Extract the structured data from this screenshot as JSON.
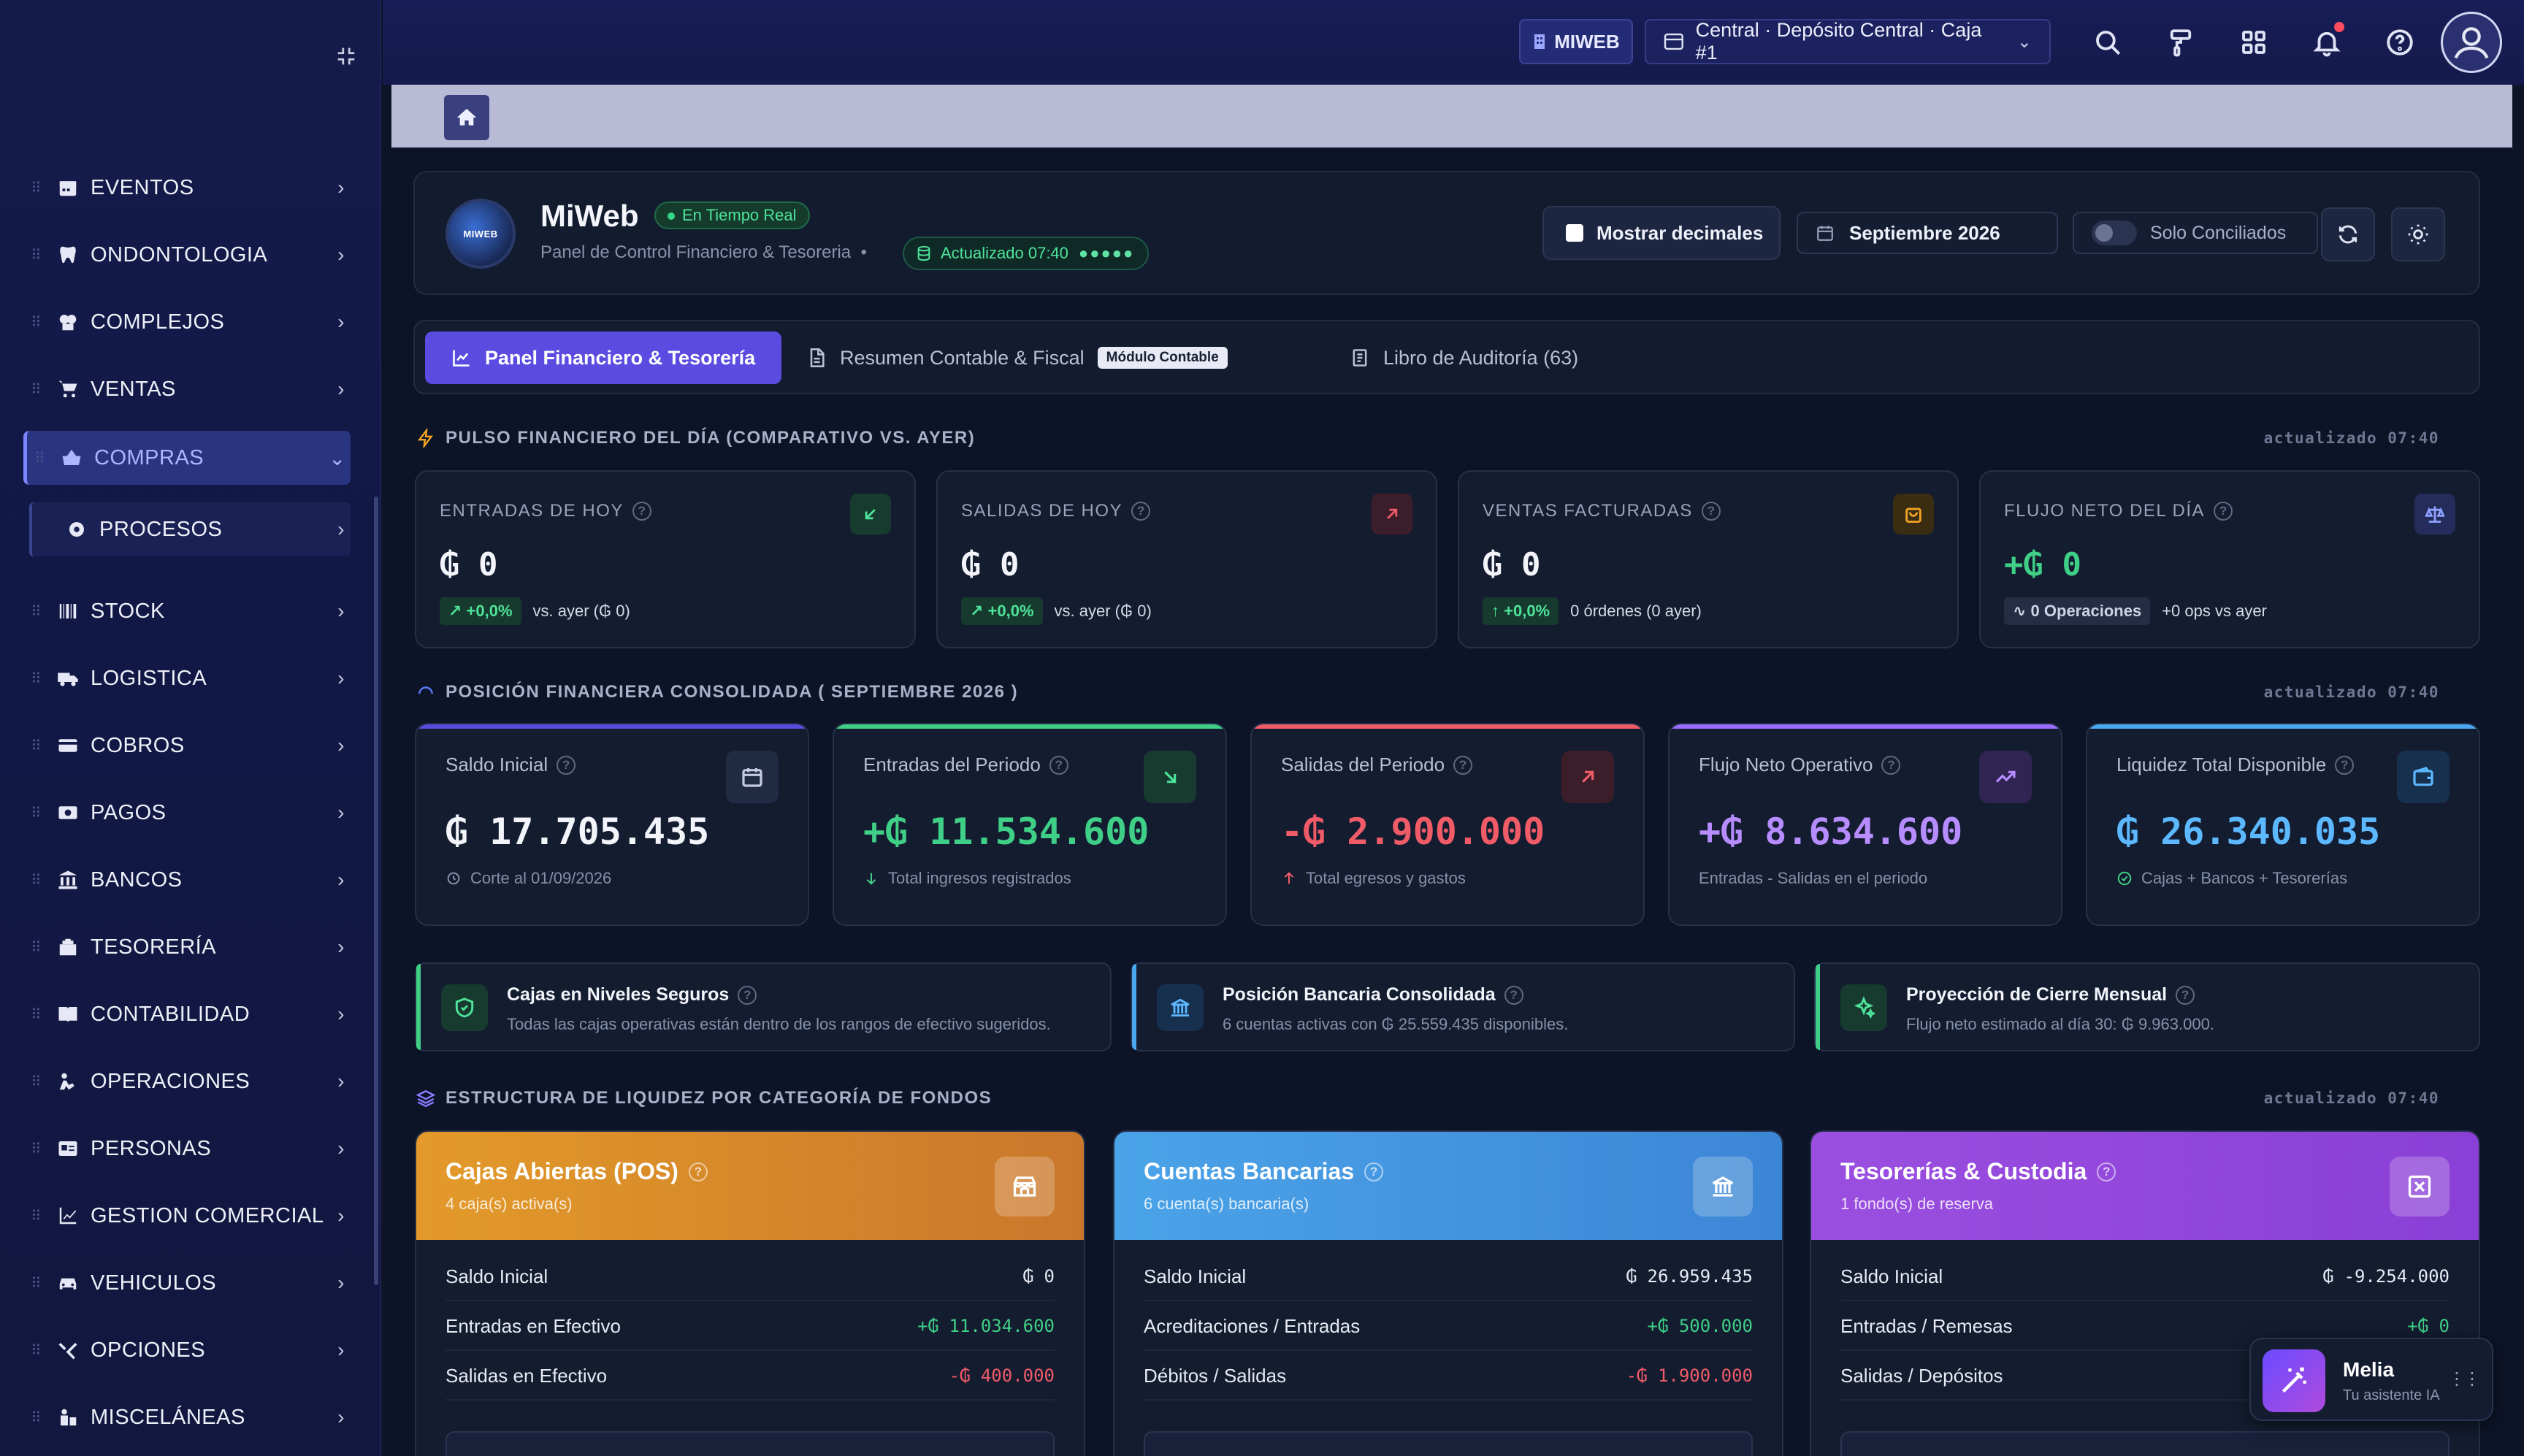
{
  "sidebar": {
    "items": [
      {
        "label": "EVENTOS",
        "icon": "calendar-icon"
      },
      {
        "label": "ONDONTOLOGIA",
        "icon": "tooth-icon"
      },
      {
        "label": "COMPLEJOS",
        "icon": "building-icon"
      },
      {
        "label": "VENTAS",
        "icon": "cart-icon"
      },
      {
        "label": "COMPRAS",
        "icon": "basket-icon",
        "active": true
      },
      {
        "label": "PROCESOS",
        "icon": "gear-icon",
        "sub": true
      },
      {
        "label": "STOCK",
        "icon": "barcode-icon"
      },
      {
        "label": "LOGISTICA",
        "icon": "truck-icon"
      },
      {
        "label": "COBROS",
        "icon": "credit-card-icon"
      },
      {
        "label": "PAGOS",
        "icon": "cash-icon"
      },
      {
        "label": "BANCOS",
        "icon": "bank-icon"
      },
      {
        "label": "TESORERÍA",
        "icon": "safe-icon"
      },
      {
        "label": "CONTABILIDAD",
        "icon": "book-icon"
      },
      {
        "label": "OPERACIONES",
        "icon": "operations-icon"
      },
      {
        "label": "PERSONAS",
        "icon": "id-card-icon"
      },
      {
        "label": "GESTION COMERCIAL",
        "icon": "chart-icon"
      },
      {
        "label": "VEHICULOS",
        "icon": "car-icon"
      },
      {
        "label": "OPCIONES",
        "icon": "tools-icon"
      },
      {
        "label": "MISCELÁNEAS",
        "icon": "misc-icon"
      }
    ]
  },
  "topbar": {
    "company_chip": "MIWEB",
    "location": "Central · Depósito Central · Caja #1"
  },
  "header": {
    "logo_text": "MIWEB",
    "app_name": "MiWeb",
    "realtime_badge": "En Tiempo Real",
    "subtitle": "Panel de Control Financiero & Tesoreria",
    "updated_badge": "Actualizado 07:40",
    "updated_dots": "●●●●●",
    "decimals_label": "Mostrar decimales",
    "month_label": "Septiembre 2026",
    "conciliados_label": "Solo Conciliados"
  },
  "tabs": {
    "financial": "Panel Financiero & Tesorería",
    "contable": "Resumen Contable & Fiscal",
    "contable_tag": "Módulo Contable",
    "audit": "Libro de Auditoría (63)"
  },
  "pulse": {
    "title": "PULSO FINANCIERO DEL DÍA (COMPARATIVO VS. AYER)",
    "updated": "actualizado 07:40",
    "cards": [
      {
        "label": "ENTRADAS DE HOY",
        "value": "₲ 0",
        "pill": "+0,0%",
        "note": "vs. ayer (₲ 0)"
      },
      {
        "label": "SALIDAS DE HOY",
        "value": "₲ 0",
        "pill": "+0,0%",
        "note": "vs. ayer (₲ 0)"
      },
      {
        "label": "VENTAS FACTURADAS",
        "value": "₲ 0",
        "pill": "+0,0%",
        "note": "0 órdenes (0 ayer)"
      },
      {
        "label": "FLUJO NETO DEL DÍA",
        "value": "+₲ 0",
        "pill": "0 Operaciones",
        "note": "+0 ops vs ayer"
      }
    ]
  },
  "position": {
    "title": "POSICIÓN FINANCIERA CONSOLIDADA ( SEPTIEMBRE 2026 )",
    "updated": "actualizado 07:40",
    "cards": [
      {
        "label": "Saldo Inicial",
        "value": "₲ 17.705.435",
        "foot": "Corte al 01/09/2026",
        "color": "#f2f4fa"
      },
      {
        "label": "Entradas del Periodo",
        "value": "+₲ 11.534.600",
        "foot": "Total ingresos registrados",
        "color": "#3fcf86"
      },
      {
        "label": "Salidas del Periodo",
        "value": "-₲ 2.900.000",
        "foot": "Total egresos y gastos",
        "color": "#f05b68"
      },
      {
        "label": "Flujo Neto Operativo",
        "value": "+₲ 8.634.600",
        "foot": "Entradas - Salidas en el periodo",
        "color": "#b68cff"
      },
      {
        "label": "Liquidez Total Disponible",
        "value": "₲ 26.340.035",
        "foot": "Cajas + Bancos + Tesorerías",
        "color": "#5cb8ff"
      }
    ]
  },
  "info": [
    {
      "title": "Cajas en Niveles Seguros",
      "desc": "Todas las cajas operativas están dentro de los rangos de efectivo sugeridos."
    },
    {
      "title": "Posición Bancaria Consolidada",
      "desc": "6 cuentas activas con ₲ 25.559.435 disponibles."
    },
    {
      "title": "Proyección de Cierre Mensual",
      "desc": "Flujo neto estimado al día 30: ₲ 9.963.000."
    }
  ],
  "funds": {
    "title": "ESTRUCTURA DE LIQUIDEZ POR CATEGORÍA DE FONDOS",
    "updated": "actualizado 07:40",
    "cards": [
      {
        "title": "Cajas Abiertas (POS)",
        "sub": "4 caja(s) activa(s)",
        "rows": [
          [
            "Saldo Inicial",
            "₲ 0"
          ],
          [
            "Entradas en Efectivo",
            "+₲ 11.034.600"
          ],
          [
            "Salidas en Efectivo",
            "-₲ 400.000"
          ]
        ]
      },
      {
        "title": "Cuentas Bancarias",
        "sub": "6 cuenta(s) bancaria(s)",
        "rows": [
          [
            "Saldo Inicial",
            "₲ 26.959.435"
          ],
          [
            "Acreditaciones / Entradas",
            "+₲ 500.000"
          ],
          [
            "Débitos / Salidas",
            "-₲ 1.900.000"
          ]
        ]
      },
      {
        "title": "Tesorerías & Custodia",
        "sub": "1 fondo(s) de reserva",
        "rows": [
          [
            "Saldo Inicial",
            "₲ -9.254.000"
          ],
          [
            "Entradas / Remesas",
            "+₲ 0"
          ],
          [
            "Salidas / Depósitos",
            ""
          ]
        ]
      }
    ]
  },
  "assistant": {
    "name": "Melia",
    "sub": "Tu asistente IA"
  }
}
